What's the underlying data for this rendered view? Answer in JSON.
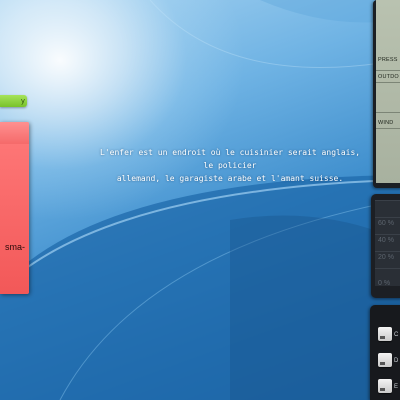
{
  "desktop": {
    "wallpaper_colors": [
      "#a9d4f1",
      "#3d8dcc",
      "#1a5c98"
    ]
  },
  "quote": {
    "line1": "L'enfer est un endroit où le cuisinier serait anglais,",
    "line2": "le policier",
    "line3": "allemand, le garagiste arabe et l'amant suisse."
  },
  "sticky_note": {
    "header_icon": "fold-icon",
    "header_glyph": "y",
    "text": "sma-",
    "color": "#f25858",
    "header_color": "#8fd43f"
  },
  "weather_gadget": {
    "labels": [
      "PRESS",
      "OUTDO",
      "WIND"
    ]
  },
  "meter_gadget": {
    "levels": [
      "60 %",
      "40 %",
      "20 %",
      "0 %"
    ]
  },
  "drive_gadget": {
    "drives": [
      "C",
      "D",
      "E"
    ],
    "icon": "hard-drive-icon"
  }
}
